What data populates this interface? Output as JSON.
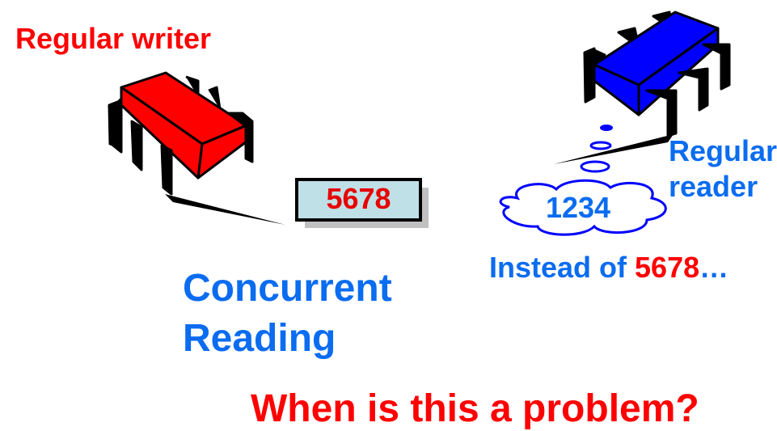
{
  "writer": {
    "label": "Regular writer",
    "color": "#ff0000"
  },
  "reader": {
    "label_line1": "Regular",
    "label_line2": "reader",
    "color": "#0000ff"
  },
  "register": {
    "value": "5678"
  },
  "thought": {
    "value": "1234"
  },
  "note": {
    "prefix": "Instead of ",
    "value": "5678",
    "suffix": "…"
  },
  "title": {
    "line1": "Concurrent",
    "line2": "Reading"
  },
  "question": "When is this a problem?",
  "colors": {
    "red": "#ff0000",
    "blue": "#0a6cf0",
    "register_fill": "#bfe0e6",
    "shadow": "#c0c0c0"
  }
}
